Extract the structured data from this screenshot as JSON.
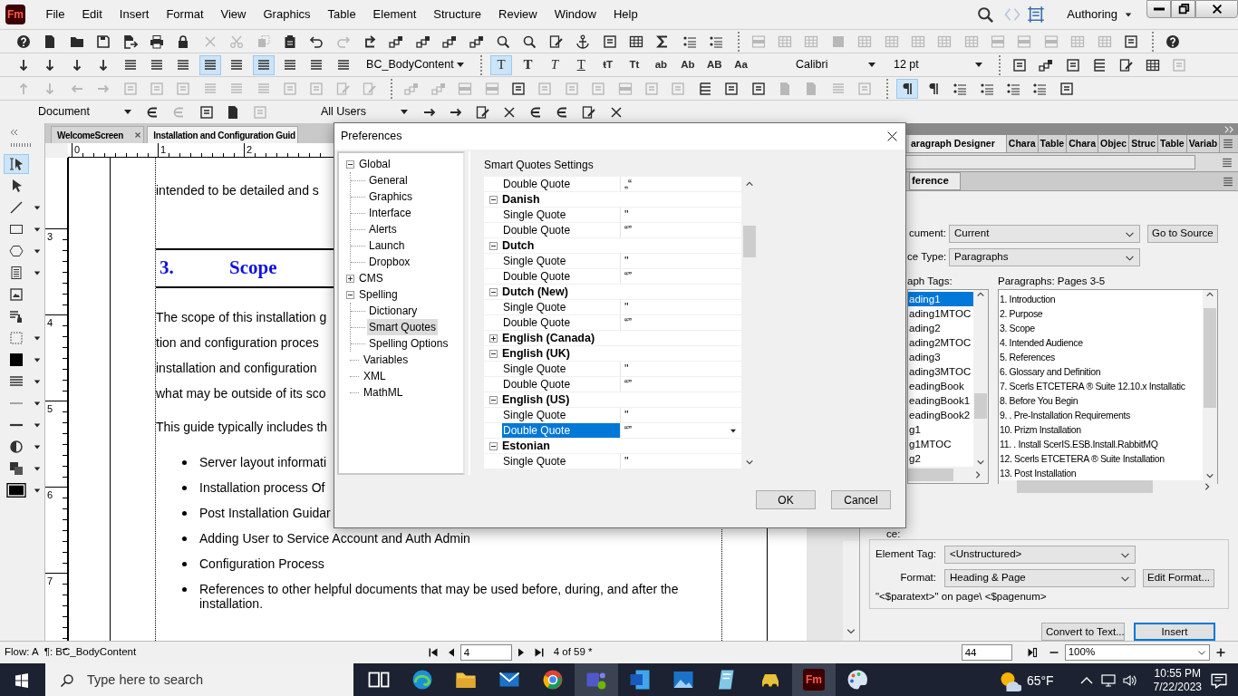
{
  "app": {
    "logo": "Fm",
    "menus": [
      "File",
      "Edit",
      "Insert",
      "Format",
      "View",
      "Graphics",
      "Table",
      "Element",
      "Structure",
      "Review",
      "Window",
      "Help"
    ],
    "workspace": "Authoring"
  },
  "toolbars": [
    {
      "items": [
        {
          "kind": "button",
          "disabled": false,
          "on": false
        },
        {
          "kind": "button",
          "disabled": false,
          "on": false
        },
        {
          "kind": "button",
          "disabled": false,
          "on": false
        },
        {
          "kind": "button",
          "disabled": false,
          "on": false
        },
        {
          "kind": "button",
          "disabled": false,
          "on": false
        },
        {
          "kind": "button",
          "disabled": false,
          "on": false
        },
        {
          "kind": "button",
          "disabled": false,
          "on": false
        },
        {
          "kind": "button",
          "disabled": true,
          "on": false
        },
        {
          "kind": "button",
          "disabled": true,
          "on": false
        },
        {
          "kind": "button",
          "disabled": true,
          "on": false
        },
        {
          "kind": "button",
          "disabled": false,
          "on": false
        },
        {
          "kind": "button",
          "disabled": false,
          "on": false
        },
        {
          "kind": "button",
          "disabled": true,
          "on": false
        },
        {
          "kind": "button",
          "disabled": false,
          "on": false
        },
        {
          "kind": "button",
          "disabled": false,
          "on": false
        },
        {
          "kind": "button",
          "disabled": false,
          "on": false
        },
        {
          "kind": "button",
          "disabled": false,
          "on": false
        },
        {
          "kind": "button",
          "disabled": false,
          "on": false
        },
        {
          "kind": "button",
          "disabled": false,
          "on": false
        },
        {
          "kind": "button",
          "disabled": false,
          "on": false
        },
        {
          "kind": "button",
          "disabled": false,
          "on": false
        },
        {
          "kind": "button",
          "disabled": false,
          "on": false
        },
        {
          "kind": "button",
          "disabled": false,
          "on": false
        },
        {
          "kind": "button",
          "disabled": false,
          "on": false
        },
        {
          "kind": "button",
          "disabled": false,
          "on": false
        },
        {
          "kind": "button",
          "disabled": false,
          "on": false
        },
        {
          "kind": "button",
          "disabled": false,
          "on": false
        },
        {
          "kind": "separator"
        },
        {
          "kind": "button",
          "disabled": true,
          "on": false
        },
        {
          "kind": "button",
          "disabled": true,
          "on": false
        },
        {
          "kind": "button",
          "disabled": true,
          "on": false
        },
        {
          "kind": "button",
          "disabled": true,
          "on": false
        },
        {
          "kind": "button",
          "disabled": true,
          "on": false
        },
        {
          "kind": "button",
          "disabled": true,
          "on": false
        },
        {
          "kind": "button",
          "disabled": true,
          "on": false
        },
        {
          "kind": "button",
          "disabled": true,
          "on": false
        },
        {
          "kind": "button",
          "disabled": true,
          "on": false
        },
        {
          "kind": "button",
          "disabled": true,
          "on": false
        },
        {
          "kind": "button",
          "disabled": true,
          "on": false
        },
        {
          "kind": "button",
          "disabled": true,
          "on": false
        },
        {
          "kind": "button",
          "disabled": true,
          "on": false
        },
        {
          "kind": "button",
          "disabled": true,
          "on": false
        },
        {
          "kind": "button",
          "disabled": false,
          "on": false
        },
        {
          "kind": "separator"
        },
        {
          "kind": "button",
          "disabled": false,
          "on": false
        }
      ]
    },
    {
      "items": [
        {
          "kind": "button",
          "disabled": false,
          "on": false
        },
        {
          "kind": "button",
          "disabled": false,
          "on": false
        },
        {
          "kind": "button",
          "disabled": false,
          "on": false
        },
        {
          "kind": "button",
          "disabled": false,
          "on": false
        },
        {
          "kind": "button",
          "disabled": false,
          "on": false
        },
        {
          "kind": "button",
          "disabled": false,
          "on": false
        },
        {
          "kind": "button",
          "disabled": false,
          "on": false
        },
        {
          "kind": "button",
          "disabled": false,
          "on": true
        },
        {
          "kind": "button",
          "disabled": false,
          "on": false
        },
        {
          "kind": "button",
          "disabled": false,
          "on": true
        },
        {
          "kind": "button",
          "disabled": false,
          "on": false
        },
        {
          "kind": "button",
          "disabled": false,
          "on": false
        },
        {
          "kind": "button",
          "disabled": false,
          "on": false
        },
        {
          "kind": "dropdown",
          "value": "BC_BodyContent"
        },
        {
          "kind": "separator"
        },
        {
          "kind": "button",
          "label": "T",
          "disabled": false,
          "on": true
        },
        {
          "kind": "button",
          "label": "T",
          "disabled": false,
          "on": false
        },
        {
          "kind": "button",
          "label": "T",
          "disabled": false,
          "on": false
        },
        {
          "kind": "button",
          "label": "T",
          "disabled": false,
          "on": false
        },
        {
          "kind": "button",
          "label": "ŧT",
          "disabled": false,
          "on": false
        },
        {
          "kind": "button",
          "label": "Tt",
          "disabled": false,
          "on": false
        },
        {
          "kind": "button",
          "label": "ab",
          "disabled": false,
          "on": false
        },
        {
          "kind": "button",
          "label": "Ab",
          "disabled": false,
          "on": false
        },
        {
          "kind": "button",
          "label": "AB",
          "disabled": false,
          "on": false
        },
        {
          "kind": "button",
          "label": "Aa",
          "disabled": false,
          "on": false
        },
        {
          "kind": "dropdown",
          "value": "Calibri"
        },
        {
          "kind": "dropdown",
          "value": "12 pt"
        },
        {
          "kind": "separator"
        },
        {
          "kind": "button",
          "disabled": false,
          "on": false
        },
        {
          "kind": "button",
          "disabled": false,
          "on": false
        },
        {
          "kind": "button",
          "disabled": false,
          "on": false
        },
        {
          "kind": "button",
          "disabled": false,
          "on": false
        },
        {
          "kind": "button",
          "disabled": false,
          "on": false
        },
        {
          "kind": "button",
          "disabled": false,
          "on": false
        },
        {
          "kind": "button",
          "disabled": true,
          "on": false
        }
      ]
    },
    {
      "items": [
        {
          "kind": "button",
          "disabled": true,
          "on": false
        },
        {
          "kind": "button",
          "disabled": true,
          "on": false
        },
        {
          "kind": "button",
          "disabled": true,
          "on": false
        },
        {
          "kind": "button",
          "disabled": true,
          "on": false
        },
        {
          "kind": "button",
          "disabled": true,
          "on": false
        },
        {
          "kind": "button",
          "disabled": true,
          "on": false
        },
        {
          "kind": "button",
          "disabled": true,
          "on": false
        },
        {
          "kind": "button",
          "disabled": true,
          "on": false
        },
        {
          "kind": "button",
          "disabled": true,
          "on": false
        },
        {
          "kind": "button",
          "disabled": true,
          "on": false
        },
        {
          "kind": "button",
          "disabled": true,
          "on": false
        },
        {
          "kind": "button",
          "disabled": true,
          "on": false
        },
        {
          "kind": "button",
          "disabled": true,
          "on": false
        },
        {
          "kind": "button",
          "disabled": true,
          "on": false
        },
        {
          "kind": "separator"
        },
        {
          "kind": "button",
          "disabled": true,
          "on": false
        },
        {
          "kind": "button",
          "disabled": true,
          "on": false
        },
        {
          "kind": "button",
          "disabled": true,
          "on": false
        },
        {
          "kind": "button",
          "disabled": true,
          "on": false
        },
        {
          "kind": "button",
          "disabled": false,
          "on": false
        },
        {
          "kind": "button",
          "disabled": true,
          "on": false
        },
        {
          "kind": "button",
          "disabled": true,
          "on": false
        },
        {
          "kind": "button",
          "disabled": true,
          "on": false
        },
        {
          "kind": "button",
          "disabled": true,
          "on": false
        },
        {
          "kind": "button",
          "disabled": true,
          "on": false
        },
        {
          "kind": "button",
          "disabled": true,
          "on": false
        },
        {
          "kind": "button",
          "disabled": false,
          "on": false
        },
        {
          "kind": "button",
          "disabled": false,
          "on": false
        },
        {
          "kind": "button",
          "disabled": false,
          "on": false
        },
        {
          "kind": "button",
          "disabled": true,
          "on": false
        },
        {
          "kind": "button",
          "disabled": true,
          "on": false
        },
        {
          "kind": "button",
          "disabled": true,
          "on": false
        },
        {
          "kind": "button",
          "disabled": true,
          "on": false
        },
        {
          "kind": "separator"
        },
        {
          "kind": "button",
          "disabled": false,
          "on": true
        },
        {
          "kind": "button",
          "disabled": false,
          "on": false
        },
        {
          "kind": "button",
          "disabled": false,
          "on": false
        },
        {
          "kind": "button",
          "disabled": false,
          "on": false
        },
        {
          "kind": "button",
          "disabled": false,
          "on": false
        },
        {
          "kind": "button",
          "disabled": false,
          "on": false
        },
        {
          "kind": "button",
          "disabled": false,
          "on": false
        }
      ]
    },
    {
      "items": [
        {
          "kind": "dropdown",
          "value": "Document"
        },
        {
          "kind": "button",
          "disabled": false,
          "on": false
        },
        {
          "kind": "button",
          "disabled": true,
          "on": false
        },
        {
          "kind": "button",
          "disabled": false,
          "on": false
        },
        {
          "kind": "button",
          "disabled": false,
          "on": false
        },
        {
          "kind": "button",
          "disabled": true,
          "on": false
        },
        {
          "kind": "dropdown",
          "value": "All Users"
        },
        {
          "kind": "button",
          "disabled": false,
          "on": false
        },
        {
          "kind": "button",
          "disabled": false,
          "on": false
        },
        {
          "kind": "button",
          "disabled": false,
          "on": false
        },
        {
          "kind": "button",
          "disabled": false,
          "on": false
        },
        {
          "kind": "button",
          "disabled": false,
          "on": false
        },
        {
          "kind": "button",
          "disabled": false,
          "on": false
        },
        {
          "kind": "button",
          "disabled": false,
          "on": false
        },
        {
          "kind": "button",
          "disabled": false,
          "on": false
        }
      ]
    }
  ],
  "tools": [
    {
      "selected": true,
      "has_menu": false
    },
    {
      "selected": false,
      "has_menu": false
    },
    {
      "selected": false,
      "has_menu": true
    },
    {
      "selected": false,
      "has_menu": true
    },
    {
      "selected": false,
      "has_menu": true
    },
    {
      "selected": false,
      "has_menu": true
    },
    {
      "selected": false,
      "has_menu": false
    },
    {
      "selected": false,
      "has_menu": false
    },
    {
      "selected": false,
      "has_menu": true
    },
    {
      "selected": false,
      "has_menu": true
    },
    {
      "selected": false,
      "has_menu": true
    },
    {
      "selected": false,
      "has_menu": true
    },
    {
      "selected": false,
      "has_menu": true
    },
    {
      "selected": false,
      "has_menu": true
    },
    {
      "selected": false,
      "has_menu": true
    },
    {
      "selected": false,
      "has_menu": true
    }
  ],
  "document": {
    "tabs": [
      {
        "label": "WelcomeScreen",
        "selected": false,
        "closable": true
      },
      {
        "label": "Installation and Configuration Guid",
        "selected": true,
        "closable": false
      }
    ],
    "ruler_h": [
      "0",
      "1",
      "2"
    ],
    "ruler_v": [
      "3",
      "4",
      "5",
      "6",
      "7"
    ],
    "blocks": [
      {
        "kind": "para",
        "lines": [
          "intended to be detailed and s"
        ]
      },
      {
        "kind": "heading",
        "number": "3.",
        "text": "Scope"
      },
      {
        "kind": "para",
        "lines": [
          "The scope of this installation g",
          "tion and configuration proces",
          "installation and configuration",
          "what may be outside of its sco"
        ]
      },
      {
        "kind": "para",
        "lines": [
          "This guide typically includes th"
        ]
      },
      {
        "kind": "bullet",
        "text": "Server layout informati"
      },
      {
        "kind": "bullet",
        "text": "Installation process Of"
      },
      {
        "kind": "bullet",
        "text": "Post Installation Guidar"
      },
      {
        "kind": "bullet",
        "text": "Adding User to Service Account and Auth Admin"
      },
      {
        "kind": "bullet",
        "text": "Configuration Process"
      },
      {
        "kind": "bullet",
        "text": "References to other helpful documents that may be used before, during, and after the installation."
      }
    ]
  },
  "right_panel": {
    "tabs": [
      {
        "label": "aragraph Designer",
        "selected": true
      },
      {
        "label": "Chara",
        "selected": false
      },
      {
        "label": "Table",
        "selected": false
      },
      {
        "label": "Chara",
        "selected": false
      },
      {
        "label": "Objec",
        "selected": false
      },
      {
        "label": "Struc",
        "selected": false
      },
      {
        "label": "Table",
        "selected": false
      },
      {
        "label": "Variab",
        "selected": false
      }
    ],
    "subtabs": [
      {
        "label": "ference",
        "selected": true
      }
    ],
    "document_label": "cument:",
    "document_value": "Current",
    "go_to_source": "Go to Source",
    "source_type_label": "ce Type:",
    "source_type_value": "Paragraphs",
    "tags_label": "aph Tags:",
    "paragraphs_label": "Paragraphs: Pages  3-5",
    "tags": [
      {
        "label": "ading1",
        "selected": true
      },
      {
        "label": "ading1MTOC",
        "selected": false
      },
      {
        "label": "ading2",
        "selected": false
      },
      {
        "label": "ading2MTOC",
        "selected": false
      },
      {
        "label": "ading3",
        "selected": false
      },
      {
        "label": "ading3MTOC",
        "selected": false
      },
      {
        "label": "eadingBook",
        "selected": false
      },
      {
        "label": "eadingBook1",
        "selected": false
      },
      {
        "label": "eadingBook2",
        "selected": false
      },
      {
        "label": "g1",
        "selected": false
      },
      {
        "label": "g1MTOC",
        "selected": false
      },
      {
        "label": "g2",
        "selected": false
      }
    ],
    "paragraphs": [
      {
        "label": "1. Introduction",
        "selected": false
      },
      {
        "label": "2. Purpose",
        "selected": false
      },
      {
        "label": "3. Scope",
        "selected": false
      },
      {
        "label": "4. Intended Audience",
        "selected": false
      },
      {
        "label": "5. References",
        "selected": false
      },
      {
        "label": "6. Glossary and Definition",
        "selected": false
      },
      {
        "label": "7. Scerls ETCETERA ® Suite 12.10.x Installatic",
        "selected": false
      },
      {
        "label": "8. Before You Begin",
        "selected": false
      },
      {
        "label": "9. . Pre-Installation Requirements",
        "selected": false
      },
      {
        "label": "10. Prizm Installation",
        "selected": false
      },
      {
        "label": "11. . Install ScerIS.ESB.Install.RabbitMQ",
        "selected": false
      },
      {
        "label": "12. Scerls ETCETERA ® Suite Installation",
        "selected": false
      },
      {
        "label": "13. Post Installation",
        "selected": false
      }
    ],
    "format_section_label": "ce:",
    "element_tag_label": "Element Tag:",
    "element_tag_value": "<Unstructured>",
    "format_label": "Format:",
    "format_value": "Heading & Page",
    "edit_format": "Edit Format...",
    "format_text": "\"<$paratext>\" on page\\ <$pagenum>",
    "convert": "Convert to Text...",
    "insert": "Insert"
  },
  "dialog": {
    "title": "Preferences",
    "tree": [
      {
        "label": "Global",
        "expanded": true,
        "selected": false,
        "children": [
          {
            "label": "General",
            "selected": false
          },
          {
            "label": "Graphics",
            "selected": false
          },
          {
            "label": "Interface",
            "selected": false
          },
          {
            "label": "Alerts",
            "selected": false
          },
          {
            "label": "Launch",
            "selected": false
          },
          {
            "label": "Dropbox",
            "selected": false
          }
        ]
      },
      {
        "label": "CMS",
        "expanded": false,
        "selected": false
      },
      {
        "label": "Spelling",
        "expanded": true,
        "selected": false,
        "children": [
          {
            "label": "Dictionary",
            "selected": false
          },
          {
            "label": "Smart Quotes",
            "selected": true
          },
          {
            "label": "Spelling Options",
            "selected": false
          }
        ]
      },
      {
        "label": "Variables",
        "selected": false
      },
      {
        "label": "XML",
        "selected": false
      },
      {
        "label": "MathML",
        "selected": false
      }
    ],
    "section_title": "Smart Quotes Settings",
    "rows": [
      {
        "kind": "property",
        "name": "Double Quote",
        "value": "„“",
        "selected": false
      },
      {
        "kind": "group",
        "name": "Danish",
        "expanded": true
      },
      {
        "kind": "property",
        "name": "Single Quote",
        "value": "''",
        "selected": false
      },
      {
        "kind": "property",
        "name": "Double Quote",
        "value": "“”",
        "selected": false
      },
      {
        "kind": "group",
        "name": "Dutch",
        "expanded": true
      },
      {
        "kind": "property",
        "name": "Single Quote",
        "value": "''",
        "selected": false
      },
      {
        "kind": "property",
        "name": "Double Quote",
        "value": "“”",
        "selected": false
      },
      {
        "kind": "group",
        "name": "Dutch (New)",
        "expanded": true
      },
      {
        "kind": "property",
        "name": "Single Quote",
        "value": "''",
        "selected": false
      },
      {
        "kind": "property",
        "name": "Double Quote",
        "value": "“”",
        "selected": false
      },
      {
        "kind": "group",
        "name": "English (Canada)",
        "expanded": false
      },
      {
        "kind": "group",
        "name": "English (UK)",
        "expanded": true
      },
      {
        "kind": "property",
        "name": "Single Quote",
        "value": "''",
        "selected": false
      },
      {
        "kind": "property",
        "name": "Double Quote",
        "value": "“”",
        "selected": false
      },
      {
        "kind": "group",
        "name": "English (US)",
        "expanded": true
      },
      {
        "kind": "property",
        "name": "Single Quote",
        "value": "''",
        "selected": false
      },
      {
        "kind": "property",
        "name": "Double Quote",
        "value": "“”",
        "selected": true
      },
      {
        "kind": "group",
        "name": "Estonian",
        "expanded": true
      },
      {
        "kind": "property",
        "name": "Single Quote",
        "value": "''",
        "selected": false
      }
    ],
    "buttons": [
      {
        "label": "OK"
      },
      {
        "label": "Cancel"
      }
    ]
  },
  "status_bar": {
    "flow": "Flow: A",
    "tag": "¶: BC_BodyContent",
    "page": "4",
    "page_count": "4 of 59 *",
    "zoom_field": "44",
    "zoom": "100%"
  },
  "taskbar": {
    "search_placeholder": "Type here to search",
    "apps": [
      {
        "active": false
      },
      {
        "active": false
      },
      {
        "active": false
      },
      {
        "active": false
      },
      {
        "active": false
      },
      {
        "active": true
      },
      {
        "active": false
      },
      {
        "active": false
      },
      {
        "active": false
      },
      {
        "active": false
      },
      {
        "active": true,
        "label": "Fm"
      },
      {
        "active": false
      }
    ],
    "weather": "65°F",
    "time": "10:55 PM",
    "date": "7/22/2023"
  }
}
